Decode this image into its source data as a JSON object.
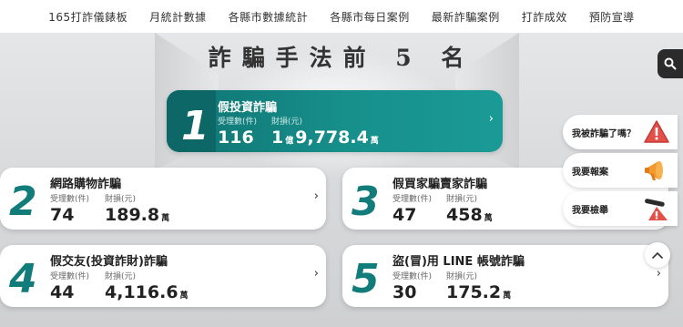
{
  "nav": {
    "items": [
      "165打詐儀錶板",
      "月統計數據",
      "各縣市數據統計",
      "各縣市每日案例",
      "最新詐騙案例",
      "打詐成效",
      "預防宣導"
    ]
  },
  "headline": "詐騙手法前 5 名",
  "labels": {
    "cases": "受理數(件)",
    "loss": "財損(元)"
  },
  "featured": {
    "rank": "1",
    "title": "假投資詐騙",
    "cases": "116",
    "loss_yi": "1",
    "yi_unit": "億",
    "loss_wan": "9,778.4",
    "wan_unit": "萬"
  },
  "cards": [
    {
      "rank": "2",
      "title": "網路購物詐騙",
      "cases": "74",
      "loss": "189.8",
      "unit": "萬"
    },
    {
      "rank": "3",
      "title": "假買家騙賣家詐騙",
      "cases": "47",
      "loss": "458",
      "unit": "萬"
    },
    {
      "rank": "4",
      "title": "假交友(投資詐財)詐騙",
      "cases": "44",
      "loss": "4,116.6",
      "unit": "萬"
    },
    {
      "rank": "5",
      "title": "盜(冒)用 LINE 帳號詐騙",
      "cases": "30",
      "loss": "175.2",
      "unit": "萬"
    }
  ],
  "side": {
    "scammed": "我被詐騙了嗎？",
    "report": "我要報案",
    "tipoff": "我要檢舉"
  },
  "chevron": "›",
  "colors": {
    "accent": "#127c7a",
    "accent_dark": "#0c6766",
    "alert_red": "#e2504a",
    "megaphone_orange": "#f29a2e"
  }
}
